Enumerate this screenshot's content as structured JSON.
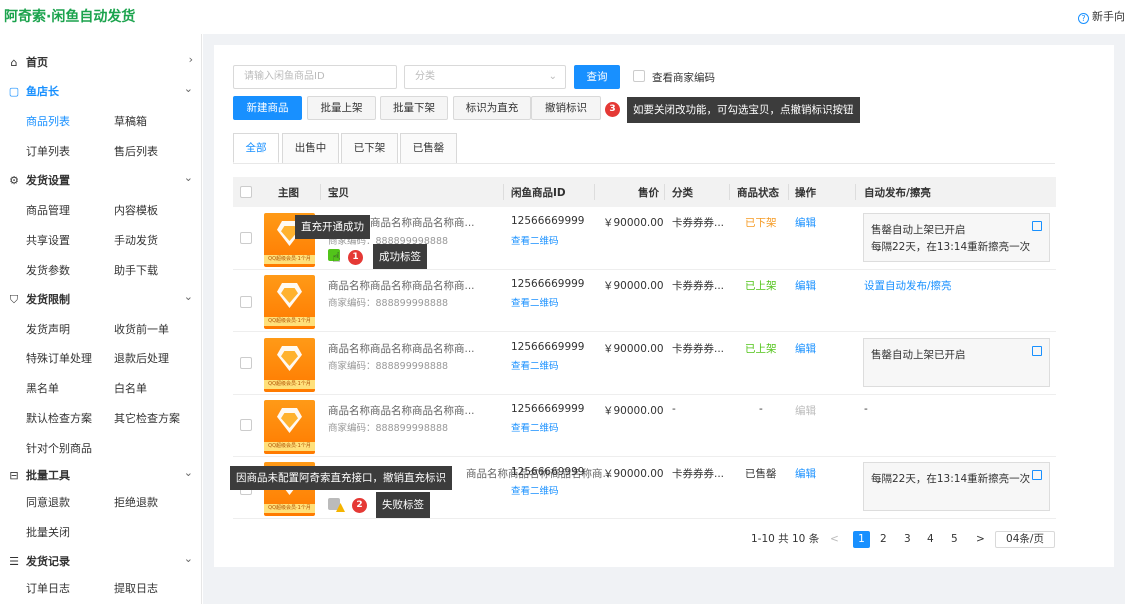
{
  "header": {
    "brand": "阿奇索·闲鱼自动发货",
    "help": "新手向"
  },
  "sidebar": {
    "home": "首页",
    "groups": [
      {
        "label": "鱼店长",
        "items": [
          "商品列表",
          "草稿箱",
          "订单列表",
          "售后列表"
        ]
      },
      {
        "label": "发货设置",
        "items": [
          "商品管理",
          "内容模板",
          "共享设置",
          "手动发货",
          "发货参数",
          "助手下载"
        ]
      },
      {
        "label": "发货限制",
        "items": [
          "发货声明",
          "收货前一单",
          "特殊订单处理",
          "退款后处理",
          "黑名单",
          "白名单",
          "默认检查方案",
          "其它检查方案",
          "针对个别商品"
        ]
      },
      {
        "label": "批量工具",
        "items": [
          "同意退款",
          "拒绝退款",
          "批量关闭"
        ]
      },
      {
        "label": "发货记录",
        "items": [
          "订单日志",
          "提取日志"
        ]
      }
    ]
  },
  "filters": {
    "id_placeholder": "请输入闲鱼商品ID",
    "category_placeholder": "分类",
    "query": "查询",
    "show_code": "查看商家编码"
  },
  "actions": {
    "new": "新建商品",
    "on": "批量上架",
    "off": "批量下架",
    "mark": "标识为直充",
    "unmark": "撤销标识"
  },
  "callouts": {
    "tip3": "如要关闭改功能，可勾选宝贝，点撤销标识按钮",
    "tip_success": "直充开通成功",
    "label1": "成功标签",
    "tip_fail": "因商品未配置阿奇索直充接口，撤销直充标识",
    "label2": "失败标签",
    "n1": "1",
    "n2": "2",
    "n3": "3"
  },
  "tabs": [
    "全部",
    "出售中",
    "已下架",
    "已售罄"
  ],
  "columns": [
    "主图",
    "宝贝",
    "闲鱼商品ID",
    "售价",
    "分类",
    "商品状态",
    "操作",
    "自动发布/擦亮"
  ],
  "rows": [
    {
      "name": "商品名称商品名称商品名称商...",
      "code": "商家编码：888899998888",
      "id": "12566669999",
      "qr": "查看二维码",
      "price": "￥90000.00",
      "cat": "卡券券券...",
      "status": "已下架",
      "status_color": "#f59a23",
      "op": "编辑",
      "auto_line1": "售罄自动上架已开启",
      "auto_line2": "每隔22天，在13:14重新擦亮一次"
    },
    {
      "name": "商品名称商品名称商品名称商...",
      "code": "商家编码：888899998888",
      "id": "12566669999",
      "qr": "查看二维码",
      "price": "￥90000.00",
      "cat": "卡券券券...",
      "status": "已上架",
      "status_color": "#52c41a",
      "op": "编辑",
      "auto_link": "设置自动发布/擦亮"
    },
    {
      "name": "商品名称商品名称商品名称商...",
      "code": "商家编码：888899998888",
      "id": "12566669999",
      "qr": "查看二维码",
      "price": "￥90000.00",
      "cat": "卡券券券...",
      "status": "已上架",
      "status_color": "#52c41a",
      "op": "编辑",
      "auto_line1": "售罄自动上架已开启"
    },
    {
      "name": "商品名称商品名称商品名称商...",
      "code": "商家编码：888899998888",
      "id": "12566669999",
      "qr": "查看二维码",
      "price": "￥90000.00",
      "cat": "-",
      "status": "-",
      "status_color": "#333333",
      "op": "编辑",
      "auto_dash": "-"
    },
    {
      "name": "商品名称商品名称商品名称商...",
      "id": "12566669999",
      "qr": "查看二维码",
      "price": "￥90000.00",
      "cat": "卡券券券...",
      "status": "已售罄",
      "status_color": "#333333",
      "op": "编辑",
      "auto_line1": "每隔22天，在13:14重新擦亮一次"
    }
  ],
  "thumb_text": "QQ超级会员·1个月",
  "pagination": {
    "summary": "1-10 共 10 条",
    "pages": [
      "1",
      "2",
      "3",
      "4",
      "5"
    ],
    "prev": "<",
    "next": ">",
    "size": "04条/页"
  },
  "colors": {
    "brand": "#1ba34d",
    "primary": "#1890ff",
    "danger": "#e53935"
  },
  "icons": {
    "home": "house-icon",
    "shop": "bag-icon",
    "settings": "gear-icon",
    "limit": "shield-icon",
    "tools": "toolbox-icon",
    "log": "log-icon"
  }
}
